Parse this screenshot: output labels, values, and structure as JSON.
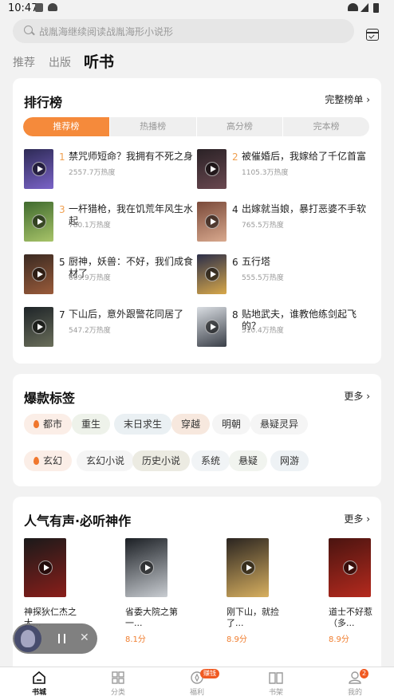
{
  "status_bar": {
    "time": "10:47"
  },
  "search": {
    "placeholder": "战胤海继续阅读战胤海形小说形"
  },
  "top_tabs": [
    "推荐",
    "出版",
    "听书"
  ],
  "ranking": {
    "title": "排行榜",
    "more": "完整榜单 ›",
    "tabs": [
      "推荐榜",
      "热播榜",
      "高分榜",
      "完本榜"
    ],
    "items": [
      {
        "rank": "1",
        "title": "禁咒师短命？我拥有不死之身",
        "heat": "2557.7万热度",
        "c1": "#2d2a55",
        "c2": "#7a63c8"
      },
      {
        "rank": "2",
        "title": "被催婚后，我嫁给了千亿首富",
        "heat": "1105.3万热度",
        "c1": "#2a2226",
        "c2": "#6a4850"
      },
      {
        "rank": "3",
        "title": "一杆猎枪，我在饥荒年风生水起",
        "heat": "780.1万热度",
        "c1": "#3f6a2e",
        "c2": "#a8c469"
      },
      {
        "rank": "4",
        "title": "出嫁就当娘，暴打恶婆不手软",
        "heat": "765.5万热度",
        "c1": "#7a4a3a",
        "c2": "#d9a98e"
      },
      {
        "rank": "5",
        "title": "厨神，妖兽：不好，我们成食材了",
        "heat": "609.9万热度",
        "c1": "#3a2a22",
        "c2": "#9a5b3a"
      },
      {
        "rank": "6",
        "title": "五行塔",
        "heat": "555.5万热度",
        "c1": "#2c2f4a",
        "c2": "#d8a84a"
      },
      {
        "rank": "7",
        "title": "下山后，意外跟警花同居了",
        "heat": "547.2万热度",
        "c1": "#1e2428",
        "c2": "#6a6e5a"
      },
      {
        "rank": "8",
        "title": "贴地武夫，谁教他练剑起飞的？",
        "heat": "510.4万热度",
        "c1": "#d9dde2",
        "c2": "#3a3f48"
      }
    ]
  },
  "tags": {
    "title": "爆款标签",
    "more": "更多 ›",
    "items": [
      {
        "label": "都市",
        "flame": true
      },
      {
        "label": "重生",
        "flame": false
      },
      {
        "label": "末日求生",
        "flame": false
      },
      {
        "label": "穿越",
        "flame": false
      },
      {
        "label": "明朝",
        "flame": false
      },
      {
        "label": "悬疑灵异",
        "flame": false
      },
      {
        "label": "玄幻",
        "flame": true
      },
      {
        "label": "玄幻小说",
        "flame": false
      },
      {
        "label": "历史小说",
        "flame": false
      },
      {
        "label": "系统",
        "flame": false
      },
      {
        "label": "悬疑",
        "flame": false
      },
      {
        "label": "网游",
        "flame": false
      }
    ],
    "tint_colors": [
      "#fbeee7",
      "#eef2ea",
      "#eaf0f3",
      "#f7e8de",
      "#f5f5f5",
      "#f5f5f5",
      "#fbeee7",
      "#f5f5f5",
      "#ecebe2",
      "#f1f4f6",
      "#f1f4ef",
      "#eef2f5"
    ]
  },
  "audio": {
    "title": "人气有声·必听神作",
    "more": "更多 ›",
    "books": [
      {
        "title": "神探狄仁杰之大...",
        "score": "",
        "c1": "#1a1a1a",
        "c2": "#8a1e1a"
      },
      {
        "title": "省委大院之第一...",
        "score": "8.1分",
        "c1": "#1b1f24",
        "c2": "#c9cdd2"
      },
      {
        "title": "刚下山，就捡了...",
        "score": "8.9分",
        "c1": "#2a2420",
        "c2": "#d8b060"
      },
      {
        "title": "道士不好惹（多...",
        "score": "8.9分",
        "c1": "#4a1410",
        "c2": "#b52a1e"
      }
    ]
  },
  "bottom_nav": {
    "items": [
      "书城",
      "分类",
      "福利",
      "书架",
      "我的"
    ],
    "welfare_badge": "赚钱",
    "mine_badge": "2"
  },
  "colors": {
    "accent": "#f58a3b",
    "score": "#f07d2e",
    "badge": "#f05a22"
  }
}
